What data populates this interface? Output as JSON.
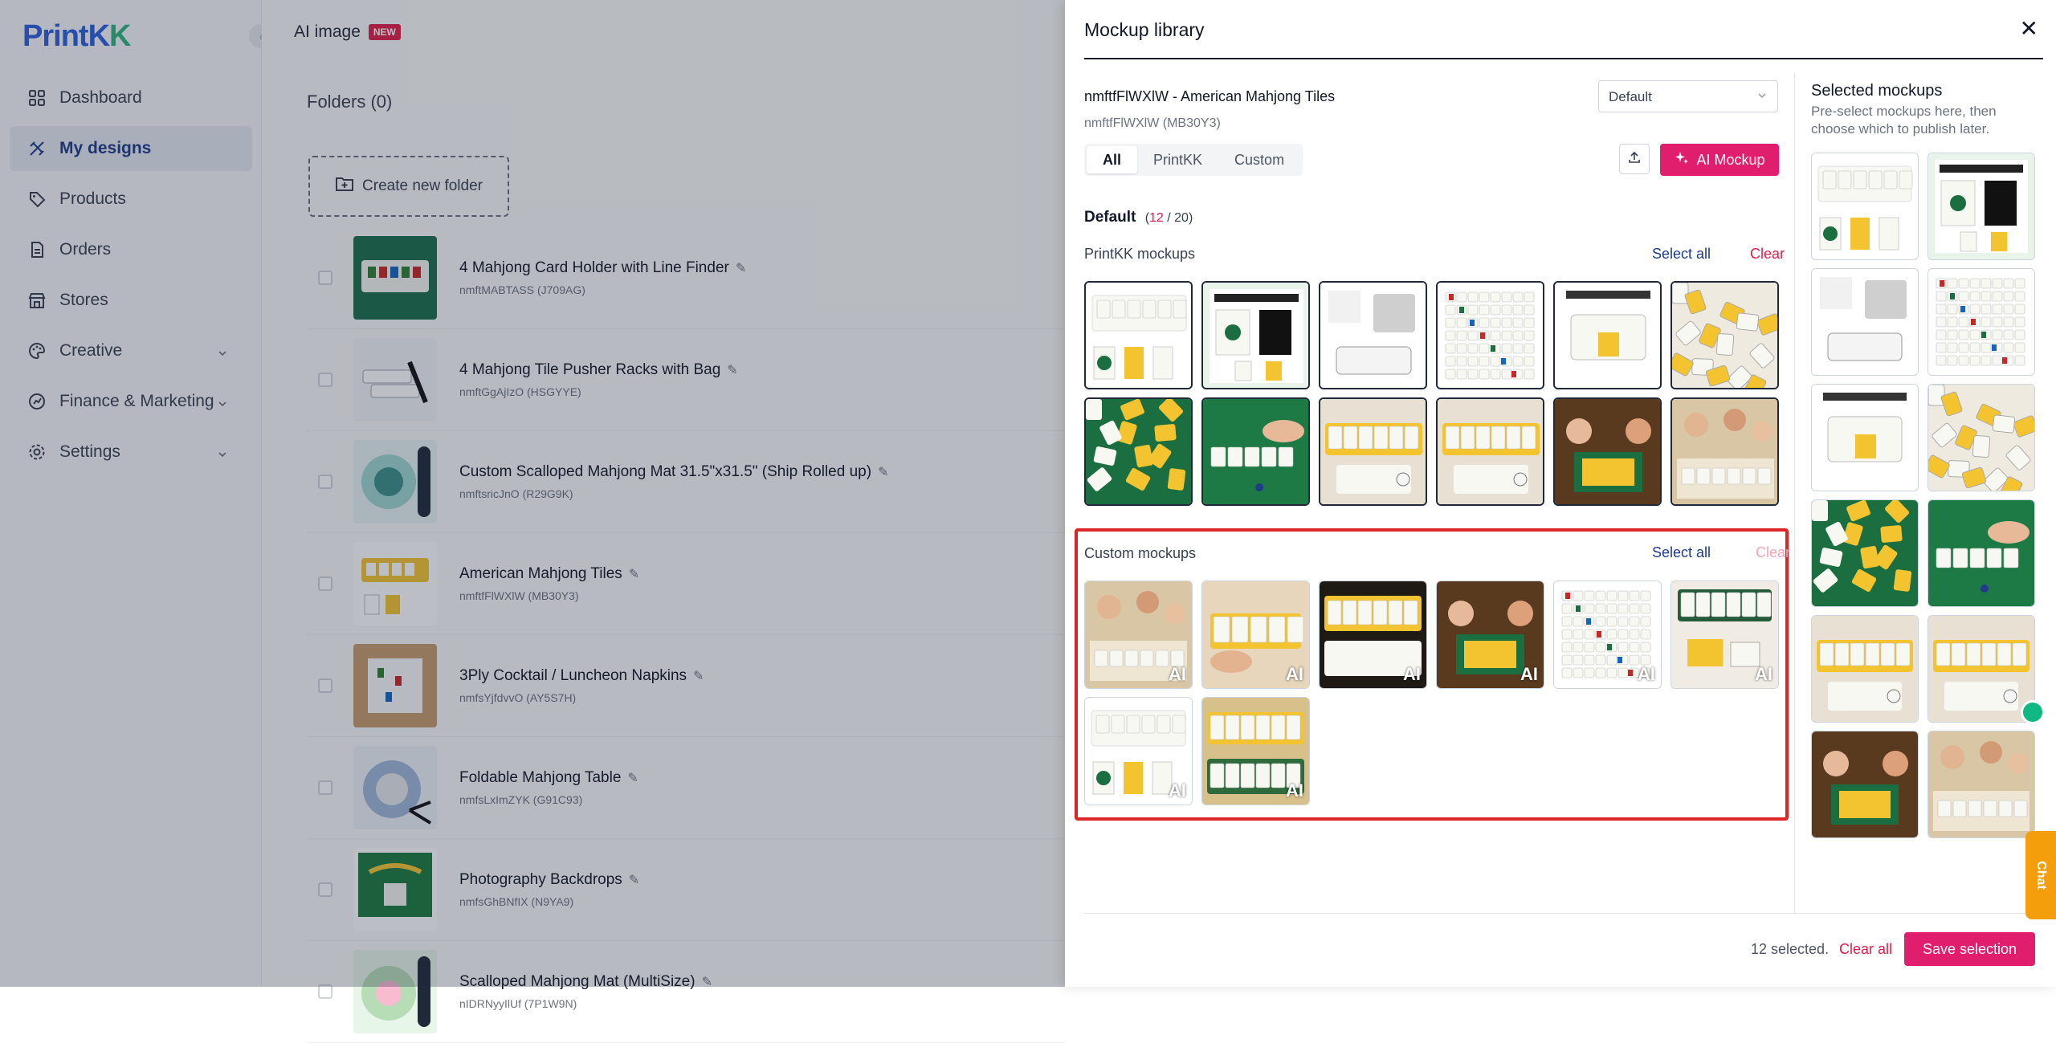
{
  "app": {
    "logo_text_a": "Print",
    "logo_text_b": "K",
    "logo_text_c": "K",
    "brand_color": "#2c5fdd",
    "accent_color": "#e11d6e"
  },
  "sidebar": {
    "items": [
      {
        "label": "Dashboard",
        "icon": "dashboard-icon"
      },
      {
        "label": "My designs",
        "icon": "designs-icon",
        "active": true
      },
      {
        "label": "Products",
        "icon": "tag-icon"
      },
      {
        "label": "Orders",
        "icon": "document-icon"
      },
      {
        "label": "Stores",
        "icon": "store-icon"
      },
      {
        "label": "Creative",
        "icon": "palette-icon",
        "expandable": true
      },
      {
        "label": "Finance & Marketing",
        "icon": "finance-icon",
        "expandable": true
      },
      {
        "label": "Settings",
        "icon": "gear-icon",
        "expandable": true
      }
    ]
  },
  "main": {
    "tab_title": "AI image",
    "new_badge": "NEW",
    "folders_title": "Folders (0)",
    "create_folder_label": "Create new folder",
    "designs": [
      {
        "name": "4 Mahjong Card Holder with Line Finder",
        "sub": "nmftMABTASS (J709AG)"
      },
      {
        "name": "4 Mahjong Tile Pusher Racks with Bag",
        "sub": "nmftGgAjIzO (HSGYYE)"
      },
      {
        "name": "Custom Scalloped Mahjong Mat 31.5\"x31.5\" (Ship Rolled up)",
        "sub": "nmftsricJnO (R29G9K)"
      },
      {
        "name": "American Mahjong Tiles",
        "sub": "nmftfFlWXlW (MB30Y3)"
      },
      {
        "name": "3Ply Cocktail / Luncheon Napkins",
        "sub": "nmfsYjfdvvO (AY5S7H)"
      },
      {
        "name": "Foldable Mahjong Table",
        "sub": "nmfsLxImZYK (G91C93)"
      },
      {
        "name": "Photography Backdrops",
        "sub": "nmfsGhBNfIX (N9YA9)"
      },
      {
        "name": "Scalloped Mahjong Mat (MultiSize)",
        "sub": "nIDRNyyIlUf (7P1W9N)"
      }
    ]
  },
  "modal": {
    "title": "Mockup library",
    "product_name": "nmftfFlWXlW - American Mahjong Tiles",
    "product_sub": "nmftfFlWXlW (MB30Y3)",
    "select_value": "Default",
    "tabs": [
      "All",
      "PrintKK",
      "Custom"
    ],
    "ai_button": "AI Mockup",
    "section_title": "Default",
    "count_selected": "12",
    "count_total": "/ 20",
    "printkk_group": "PrintKK mockups",
    "custom_group": "Custom mockups",
    "select_all": "Select all",
    "clear": "Clear",
    "ai_tag": "AI",
    "printkk_tiles": [
      "product",
      "product-size",
      "storage-size",
      "166-piece",
      "easy-to-store",
      "scatter",
      "green-felt",
      "hand-tiles",
      "rack-table",
      "rack-close",
      "family-night",
      "friends-play"
    ],
    "custom_tiles": [
      "friends-patio",
      "hands-rack",
      "rack-dark",
      "party-table",
      "tiles-rows",
      "tiles-case",
      "rack-closeup",
      "tiles-leaves"
    ],
    "selected_title": "Selected mockups",
    "selected_sub": "Pre-select mockups here, then choose which to publish later.",
    "selected_count": "12 selected.",
    "clear_all": "Clear all",
    "save_button": "Save selection",
    "chat_label": "Chat"
  }
}
